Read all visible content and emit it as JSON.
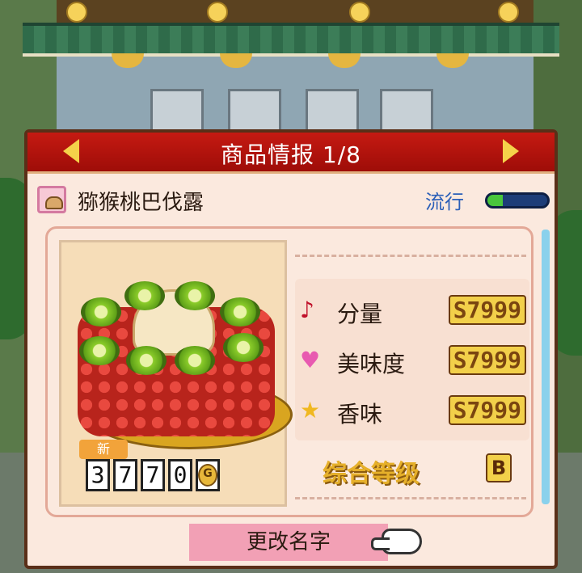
{
  "panel": {
    "title": "商品情报 1/8"
  },
  "item": {
    "icon": "bun-icon",
    "name": "猕猴桃巴伐露",
    "trend_label": "流行",
    "trend_level": 0.25
  },
  "price": {
    "new_badge": "新",
    "digits": [
      "3",
      "7",
      "7",
      "0"
    ],
    "currency": "G"
  },
  "stats": [
    {
      "icon": "note-icon",
      "label": "分量",
      "value": "S7999"
    },
    {
      "icon": "heart-icon",
      "label": "美味度",
      "value": "S7999"
    },
    {
      "icon": "star-icon",
      "label": "香味",
      "value": "S7999"
    }
  ],
  "rank": {
    "label": "综合等级",
    "value": "B"
  },
  "actions": {
    "rename": "更改名字"
  },
  "colors": {
    "title_bar": "#b8130c",
    "panel_bg": "#fbe9de",
    "trend_fill": "#49c63c",
    "rename_button": "#f2a0b5"
  }
}
